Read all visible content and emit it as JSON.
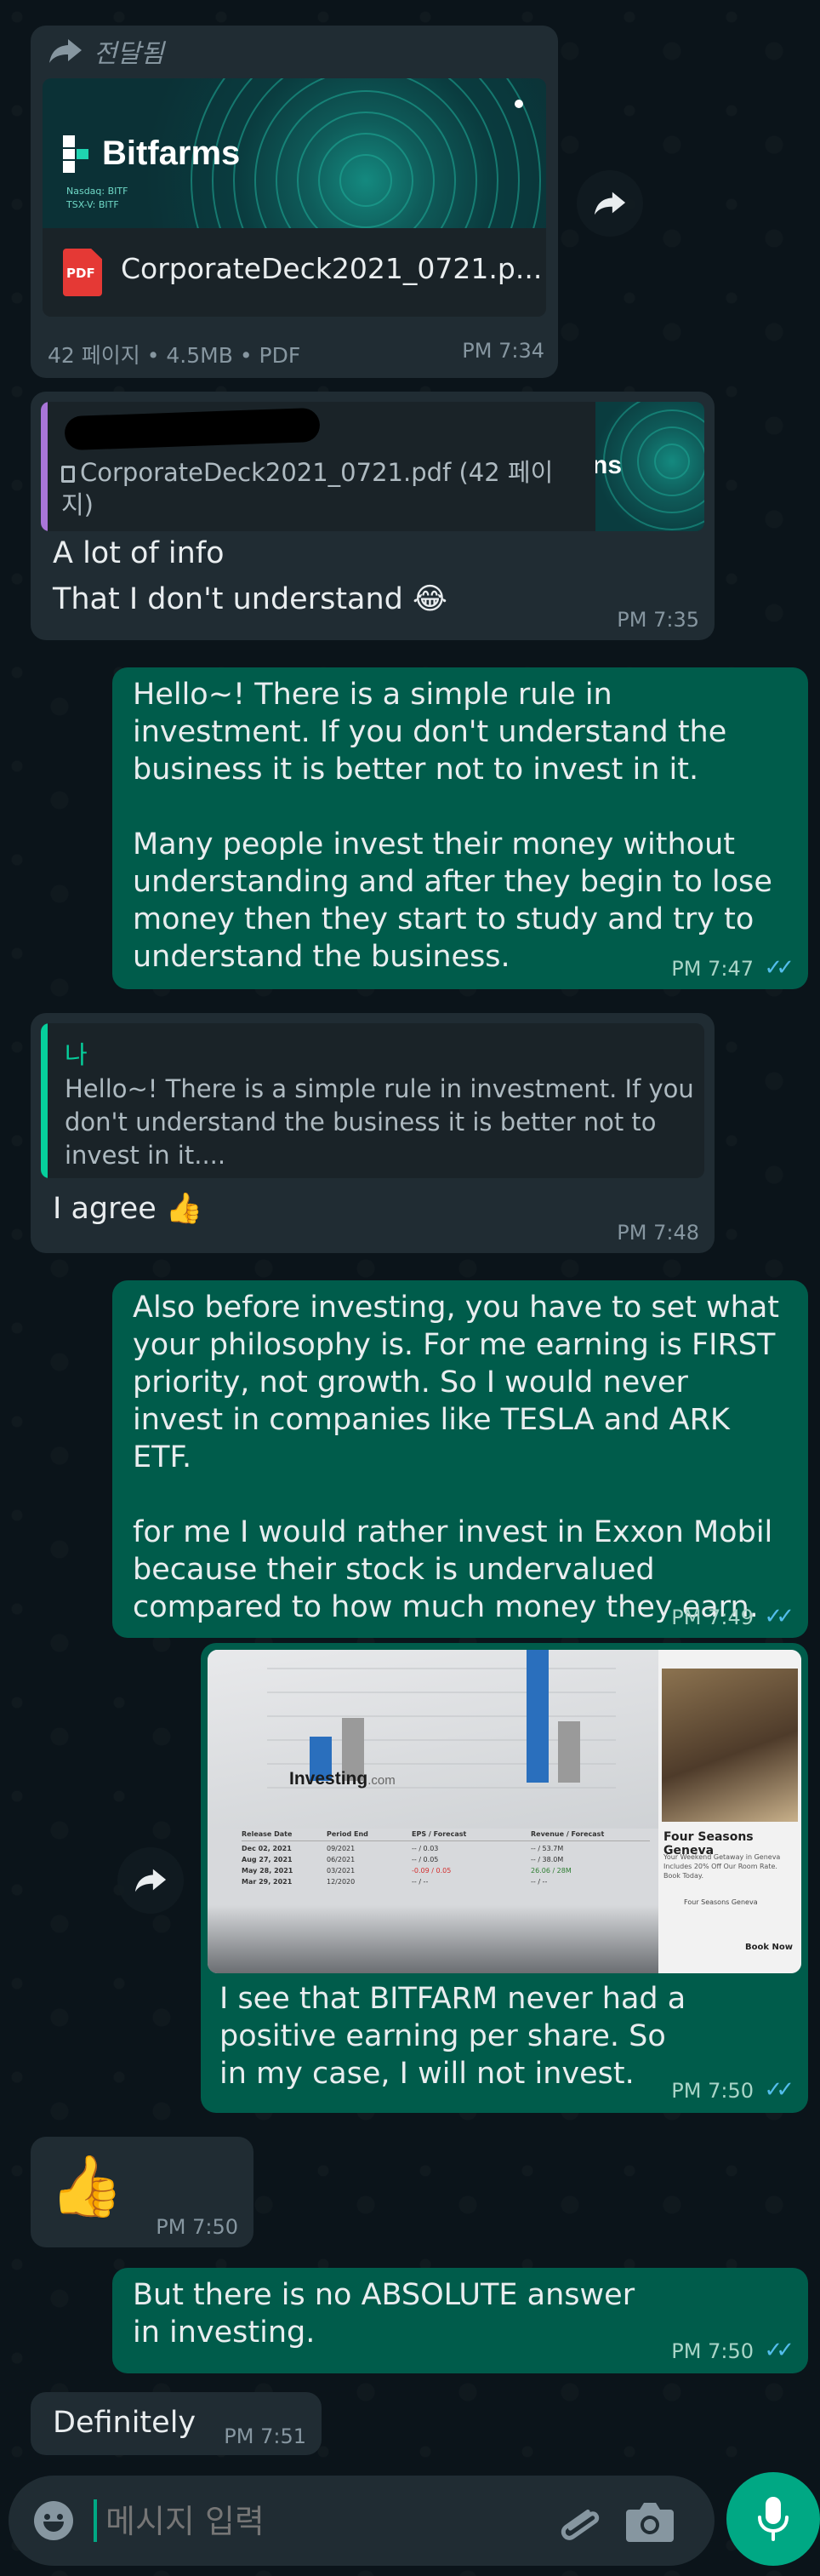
{
  "forwarded": {
    "label": "전달됨",
    "brand_name": "Bitfarms",
    "brand_sub1": "Nasdaq: BITF",
    "brand_sub2": "TSX-V: BITF",
    "file_badge": "PDF",
    "file_name": "CorporateDeck2021_0721.p...",
    "meta": "42 페이지 • 4.5MB • PDF",
    "time": "PM 7:34"
  },
  "reply1": {
    "quoted_file": "CorporateDeck2021_0721.pdf (42 페이지)",
    "thumb_text": "ns",
    "text_line1": "A lot of info",
    "text_line2": "That I don't understand 😂",
    "time": "PM 7:35"
  },
  "msg_out1": {
    "text": "Hello~! There is a simple rule in investment. If you don't understand the business it is better not to invest in it.\n\nMany people invest their money without understanding and after they begin to lose money then they start to study and try to understand the business.",
    "time": "PM 7:47",
    "ticks": "✓✓"
  },
  "reply2": {
    "quote_author": "나",
    "quote_text": "Hello~! There is a simple rule in investment. If you don't understand the business it is better not to invest in it....",
    "text": "I agree 👍",
    "time": "PM 7:48"
  },
  "msg_out2": {
    "text": "Also before investing, you have to set what your philosophy is. For me earning is FIRST priority, not growth. So I would never invest in companies like TESLA and ARK ETF.\n\nfor me I would rather invest in Exxon Mobil because their stock is undervalued compared to how much money they earn.",
    "time": "PM 7:49",
    "ticks": "✓✓"
  },
  "msg_out3": {
    "image_logo": "Investing",
    "image_logo_suffix": ".com",
    "image_ad_title": "Four Seasons Geneva",
    "image_ad_text": "Your Weekend Getaway in Geneva Includes 20% Off Our Room Rate. Book Today.",
    "image_ad_brand": "Four Seasons Geneva",
    "image_ad_cta": "Book Now",
    "image_table_headers": [
      "Release Date",
      "Period End",
      "EPS / Forecast",
      "Revenue / Forecast"
    ],
    "image_table_rows": [
      [
        "Dec 02, 2021",
        "09/2021",
        "-- / 0.03",
        "-- / 53.7M"
      ],
      [
        "Aug 27, 2021",
        "06/2021",
        "-- / 0.05",
        "-- / 38.0M"
      ],
      [
        "May 28, 2021",
        "03/2021",
        "-0.09 / 0.05",
        "26.06 / 28M"
      ],
      [
        "Mar 29, 2021",
        "12/2020",
        "-- / --",
        "-- / --"
      ]
    ],
    "text": "I see that BITFARM never had a positive earning per share. So in my case, I will not invest.",
    "time": "PM 7:50",
    "ticks": "✓✓"
  },
  "msg_in_thumb": {
    "emoji": "👍",
    "time": "PM 7:50"
  },
  "msg_out4": {
    "text": "But there is no ABSOLUTE answer in investing.",
    "time": "PM 7:50",
    "ticks": "✓✓"
  },
  "msg_in_def": {
    "text": "Definitely",
    "time": "PM 7:51"
  },
  "input": {
    "placeholder": "메시지 입력"
  },
  "colors": {
    "bg": "#0b141a",
    "incoming": "#202c33",
    "outgoing": "#005c4b",
    "accent": "#00a884",
    "ticks": "#53bdeb",
    "pdf_red": "#e53935"
  },
  "icons": [
    "forward-icon",
    "pdf-icon",
    "document-icon",
    "thumbs-up-icon",
    "emoji-icon",
    "attach-icon",
    "camera-icon",
    "mic-icon"
  ]
}
